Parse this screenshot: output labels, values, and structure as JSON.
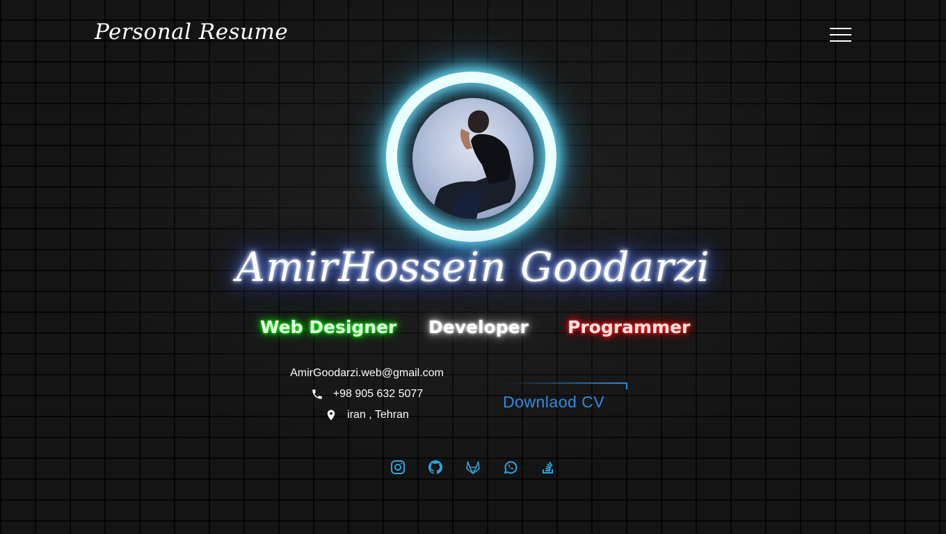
{
  "header": {
    "brand": "Personal Resume",
    "menu_icon": "hamburger-menu-icon"
  },
  "profile": {
    "name": "AmirHossein Goodarzi",
    "photo_icon": "profile-photo"
  },
  "roles": [
    {
      "label": "Web Designer",
      "color": "#00ff00"
    },
    {
      "label": "Developer",
      "color": "#ffffff"
    },
    {
      "label": "Programmer",
      "color": "#ff0000"
    }
  ],
  "contact": {
    "email": "AmirGoodarzi.web@gmail.com",
    "phone": "+98 905 632 5077",
    "location": "iran , Tehran",
    "phone_icon": "phone-icon",
    "location_icon": "location-pin-icon"
  },
  "cv_button": {
    "label": "Downlaod CV",
    "color": "#2b8ce6"
  },
  "social": {
    "color": "#29a8e0",
    "icons": [
      "instagram-icon",
      "github-icon",
      "gitlab-icon",
      "whatsapp-icon",
      "stackoverflow-icon"
    ]
  },
  "colors": {
    "background": "#141414",
    "glow_blue": "#6ee6ff"
  }
}
